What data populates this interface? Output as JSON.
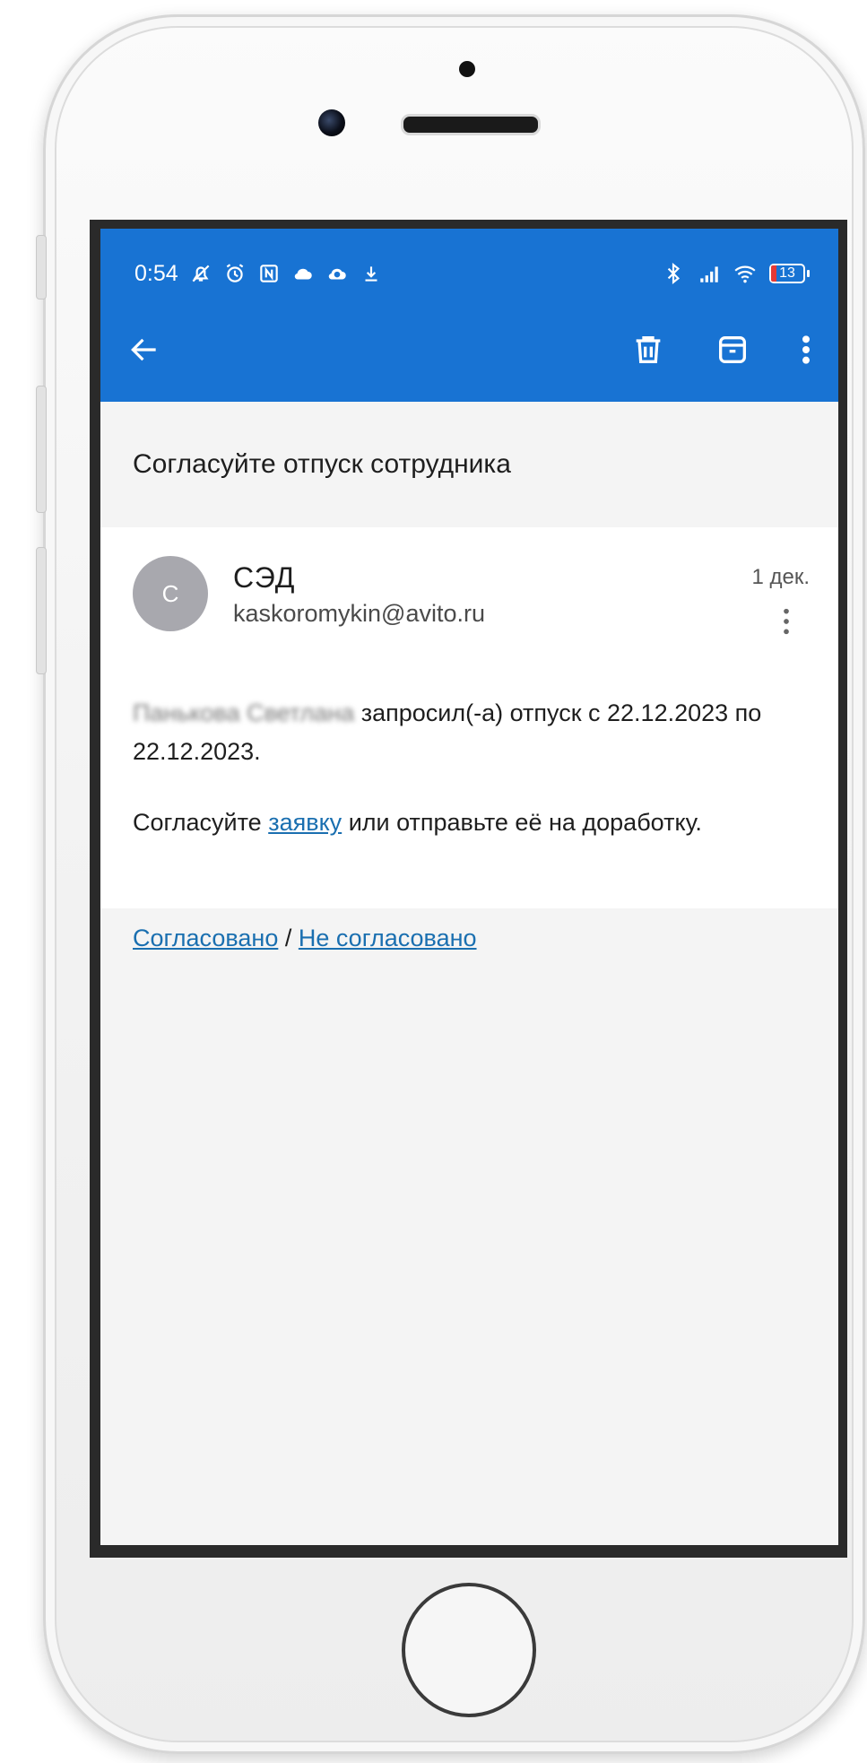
{
  "status_bar": {
    "time": "0:54",
    "battery": "13",
    "left_icons": [
      "muted-notifications-icon",
      "alarm-icon",
      "nfc-icon",
      "cloud-icon",
      "cloud-sync-icon",
      "download-icon"
    ],
    "right_icons": [
      "bluetooth-icon",
      "signal-icon",
      "wifi-icon",
      "battery-icon"
    ]
  },
  "toolbar": {
    "back_icon": "back-arrow-icon",
    "actions": [
      "delete-icon",
      "archive-icon",
      "more-vertical-icon"
    ]
  },
  "email": {
    "subject": "Согласуйте отпуск сотрудника",
    "sender": {
      "avatar_letter": "С",
      "name": "СЭД",
      "address": "kaskoromykin@avito.ru"
    },
    "date": "1 дек.",
    "body": {
      "blurred_name": "Панькова Светлана",
      "line1_rest": " запросил(-а) отпуск с 22.12.2023 по 22.12.2023.",
      "para2_before": "Согласуйте ",
      "para2_link": "заявку",
      "para2_after": " или отправьте её на доработку.",
      "approve_link": "Согласовано",
      "separator": " / ",
      "reject_link": "Не согласовано"
    }
  },
  "colors": {
    "appbar": "#1873d3",
    "link": "#1a6fb0",
    "avatar": "#a8a8ae"
  }
}
